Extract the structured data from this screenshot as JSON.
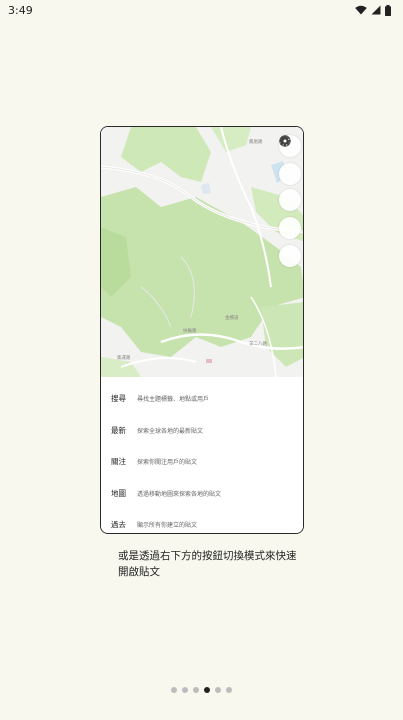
{
  "status_bar": {
    "time": "3:49"
  },
  "map": {
    "road_labels": [
      "鳳凰路",
      "扶輪路",
      "金橋道",
      "羊二八路",
      "集運路"
    ],
    "side_buttons": [
      {
        "icon": "bell-icon"
      },
      {
        "icon": "user-icon"
      },
      {
        "icon": "chat-icon"
      },
      {
        "icon": "heart-icon"
      },
      {
        "icon": "gear-icon"
      }
    ]
  },
  "tips": [
    {
      "label": "搜尋",
      "desc": "尋找主題標籤、地點或用戶"
    },
    {
      "label": "最新",
      "desc": "探索全球各地的最新貼文"
    },
    {
      "label": "關注",
      "desc": "探索你關注用戶的貼文"
    },
    {
      "label": "地圖",
      "desc": "透過移動地圖來探索各地的貼文"
    },
    {
      "label": "過去",
      "desc": "顯示所有你建立的貼文"
    }
  ],
  "caption": "或是透過右下方的按鈕切換模式來快速開啟貼文",
  "pagination": {
    "total": 6,
    "active_index": 3
  }
}
